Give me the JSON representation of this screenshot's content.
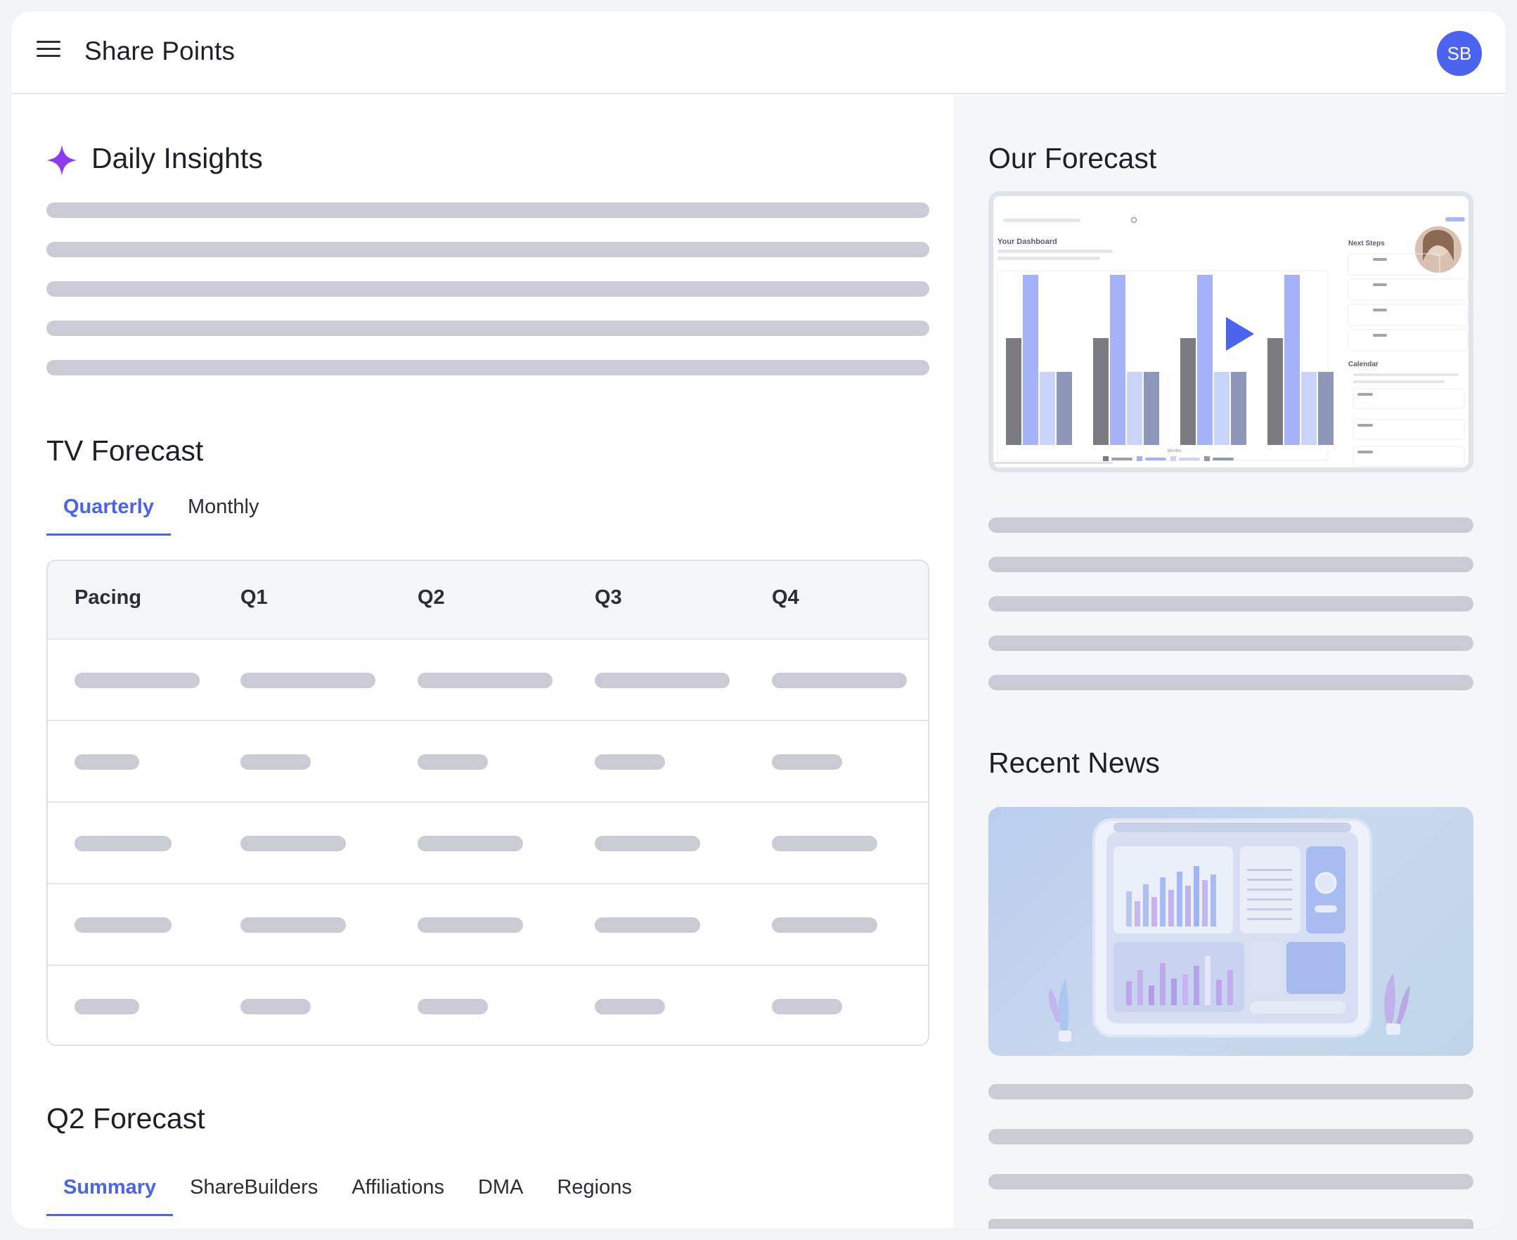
{
  "header": {
    "title": "Share Points",
    "avatar_initials": "SB"
  },
  "daily_insights": {
    "title": "Daily Insights"
  },
  "tv_forecast": {
    "title": "TV Forecast",
    "tabs": [
      {
        "label": "Quarterly",
        "active": true
      },
      {
        "label": "Monthly",
        "active": false
      }
    ],
    "table": {
      "columns": [
        "Pacing",
        "Q1",
        "Q2",
        "Q3",
        "Q4"
      ]
    }
  },
  "q2_forecast": {
    "title": "Q2 Forecast",
    "tabs": [
      {
        "label": "Summary",
        "active": true
      },
      {
        "label": "ShareBuilders",
        "active": false
      },
      {
        "label": "Affiliations",
        "active": false
      },
      {
        "label": "DMA",
        "active": false
      },
      {
        "label": "Regions",
        "active": false
      }
    ]
  },
  "our_forecast": {
    "title": "Our Forecast",
    "video": {
      "dashboard_title": "Your Dashboard",
      "next_steps_label": "Next Steps",
      "calendar_label": "Calendar",
      "x_axis_label": "Months"
    }
  },
  "recent_news": {
    "title": "Recent News"
  },
  "colors": {
    "accent": "#4a64ef",
    "skeleton": "#c9ccd4",
    "sparkle": "#8b3cf0"
  },
  "icons": {
    "menu": "hamburger-menu-icon",
    "sparkle": "sparkle-icon",
    "play": "play-icon"
  }
}
